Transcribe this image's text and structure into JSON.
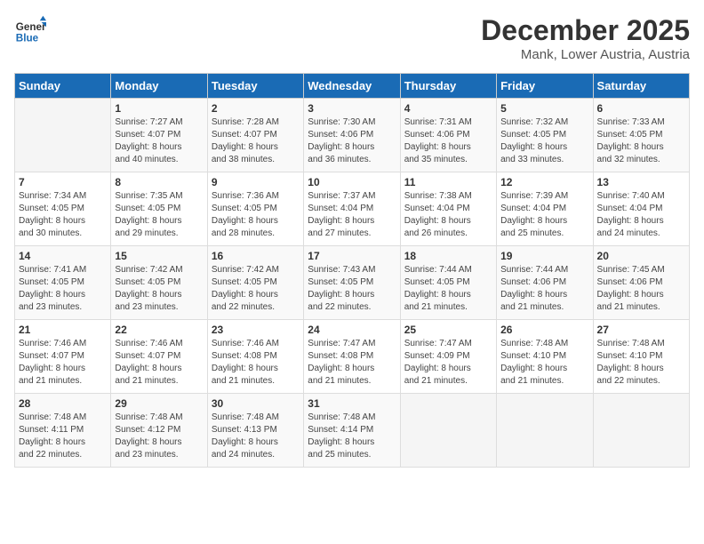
{
  "header": {
    "logo_line1": "General",
    "logo_line2": "Blue",
    "month": "December 2025",
    "location": "Mank, Lower Austria, Austria"
  },
  "days_of_week": [
    "Sunday",
    "Monday",
    "Tuesday",
    "Wednesday",
    "Thursday",
    "Friday",
    "Saturday"
  ],
  "weeks": [
    [
      {
        "day": "",
        "content": ""
      },
      {
        "day": "1",
        "content": "Sunrise: 7:27 AM\nSunset: 4:07 PM\nDaylight: 8 hours\nand 40 minutes."
      },
      {
        "day": "2",
        "content": "Sunrise: 7:28 AM\nSunset: 4:07 PM\nDaylight: 8 hours\nand 38 minutes."
      },
      {
        "day": "3",
        "content": "Sunrise: 7:30 AM\nSunset: 4:06 PM\nDaylight: 8 hours\nand 36 minutes."
      },
      {
        "day": "4",
        "content": "Sunrise: 7:31 AM\nSunset: 4:06 PM\nDaylight: 8 hours\nand 35 minutes."
      },
      {
        "day": "5",
        "content": "Sunrise: 7:32 AM\nSunset: 4:05 PM\nDaylight: 8 hours\nand 33 minutes."
      },
      {
        "day": "6",
        "content": "Sunrise: 7:33 AM\nSunset: 4:05 PM\nDaylight: 8 hours\nand 32 minutes."
      }
    ],
    [
      {
        "day": "7",
        "content": "Sunrise: 7:34 AM\nSunset: 4:05 PM\nDaylight: 8 hours\nand 30 minutes."
      },
      {
        "day": "8",
        "content": "Sunrise: 7:35 AM\nSunset: 4:05 PM\nDaylight: 8 hours\nand 29 minutes."
      },
      {
        "day": "9",
        "content": "Sunrise: 7:36 AM\nSunset: 4:05 PM\nDaylight: 8 hours\nand 28 minutes."
      },
      {
        "day": "10",
        "content": "Sunrise: 7:37 AM\nSunset: 4:04 PM\nDaylight: 8 hours\nand 27 minutes."
      },
      {
        "day": "11",
        "content": "Sunrise: 7:38 AM\nSunset: 4:04 PM\nDaylight: 8 hours\nand 26 minutes."
      },
      {
        "day": "12",
        "content": "Sunrise: 7:39 AM\nSunset: 4:04 PM\nDaylight: 8 hours\nand 25 minutes."
      },
      {
        "day": "13",
        "content": "Sunrise: 7:40 AM\nSunset: 4:04 PM\nDaylight: 8 hours\nand 24 minutes."
      }
    ],
    [
      {
        "day": "14",
        "content": "Sunrise: 7:41 AM\nSunset: 4:05 PM\nDaylight: 8 hours\nand 23 minutes."
      },
      {
        "day": "15",
        "content": "Sunrise: 7:42 AM\nSunset: 4:05 PM\nDaylight: 8 hours\nand 23 minutes."
      },
      {
        "day": "16",
        "content": "Sunrise: 7:42 AM\nSunset: 4:05 PM\nDaylight: 8 hours\nand 22 minutes."
      },
      {
        "day": "17",
        "content": "Sunrise: 7:43 AM\nSunset: 4:05 PM\nDaylight: 8 hours\nand 22 minutes."
      },
      {
        "day": "18",
        "content": "Sunrise: 7:44 AM\nSunset: 4:05 PM\nDaylight: 8 hours\nand 21 minutes."
      },
      {
        "day": "19",
        "content": "Sunrise: 7:44 AM\nSunset: 4:06 PM\nDaylight: 8 hours\nand 21 minutes."
      },
      {
        "day": "20",
        "content": "Sunrise: 7:45 AM\nSunset: 4:06 PM\nDaylight: 8 hours\nand 21 minutes."
      }
    ],
    [
      {
        "day": "21",
        "content": "Sunrise: 7:46 AM\nSunset: 4:07 PM\nDaylight: 8 hours\nand 21 minutes."
      },
      {
        "day": "22",
        "content": "Sunrise: 7:46 AM\nSunset: 4:07 PM\nDaylight: 8 hours\nand 21 minutes."
      },
      {
        "day": "23",
        "content": "Sunrise: 7:46 AM\nSunset: 4:08 PM\nDaylight: 8 hours\nand 21 minutes."
      },
      {
        "day": "24",
        "content": "Sunrise: 7:47 AM\nSunset: 4:08 PM\nDaylight: 8 hours\nand 21 minutes."
      },
      {
        "day": "25",
        "content": "Sunrise: 7:47 AM\nSunset: 4:09 PM\nDaylight: 8 hours\nand 21 minutes."
      },
      {
        "day": "26",
        "content": "Sunrise: 7:48 AM\nSunset: 4:10 PM\nDaylight: 8 hours\nand 21 minutes."
      },
      {
        "day": "27",
        "content": "Sunrise: 7:48 AM\nSunset: 4:10 PM\nDaylight: 8 hours\nand 22 minutes."
      }
    ],
    [
      {
        "day": "28",
        "content": "Sunrise: 7:48 AM\nSunset: 4:11 PM\nDaylight: 8 hours\nand 22 minutes."
      },
      {
        "day": "29",
        "content": "Sunrise: 7:48 AM\nSunset: 4:12 PM\nDaylight: 8 hours\nand 23 minutes."
      },
      {
        "day": "30",
        "content": "Sunrise: 7:48 AM\nSunset: 4:13 PM\nDaylight: 8 hours\nand 24 minutes."
      },
      {
        "day": "31",
        "content": "Sunrise: 7:48 AM\nSunset: 4:14 PM\nDaylight: 8 hours\nand 25 minutes."
      },
      {
        "day": "",
        "content": ""
      },
      {
        "day": "",
        "content": ""
      },
      {
        "day": "",
        "content": ""
      }
    ]
  ]
}
